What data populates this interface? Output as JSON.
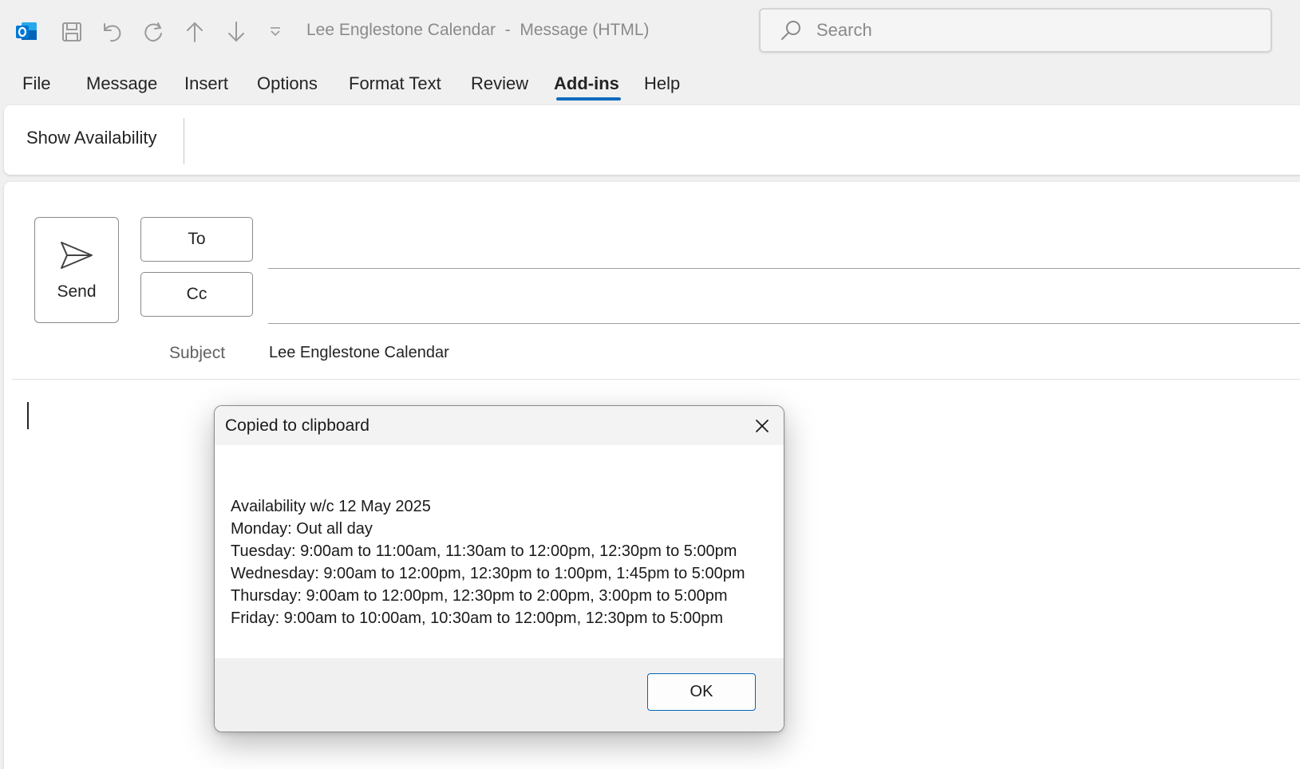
{
  "window": {
    "title": "Lee Englestone Calendar  -  Message (HTML)",
    "search_placeholder": "Search"
  },
  "tabs": [
    {
      "label": "File"
    },
    {
      "label": "Message"
    },
    {
      "label": "Insert"
    },
    {
      "label": "Options"
    },
    {
      "label": "Format Text"
    },
    {
      "label": "Review"
    },
    {
      "label": "Add-ins",
      "active": true
    },
    {
      "label": "Help"
    }
  ],
  "ribbon": {
    "show_availability_label": "Show Availability"
  },
  "compose": {
    "send_label": "Send",
    "to_label": "To",
    "cc_label": "Cc",
    "subject_label": "Subject",
    "subject_value": "Lee Englestone Calendar"
  },
  "dialog": {
    "title": "Copied to clipboard",
    "lines": [
      "Availability w/c 12 May 2025",
      "Monday: Out all day",
      "Tuesday: 9:00am to 11:00am, 11:30am to 12:00pm, 12:30pm to 5:00pm",
      "Wednesday: 9:00am to 12:00pm, 12:30pm to 1:00pm, 1:45pm to 5:00pm",
      "Thursday: 9:00am to 12:00pm, 12:30pm to 2:00pm, 3:00pm to 5:00pm",
      "Friday: 9:00am to 10:00am, 10:30am to 12:00pm, 12:30pm to 5:00pm"
    ],
    "ok_label": "OK"
  },
  "colors": {
    "accent": "#0f6cbd",
    "outlook_blue": "#0078d4",
    "ok_border": "#0067c0"
  },
  "icons": [
    "outlook-icon",
    "save-icon",
    "undo-icon",
    "redo-icon",
    "arrow-up-icon",
    "arrow-down-icon",
    "customize-toolbar-icon",
    "search-icon",
    "send-icon",
    "close-icon"
  ]
}
